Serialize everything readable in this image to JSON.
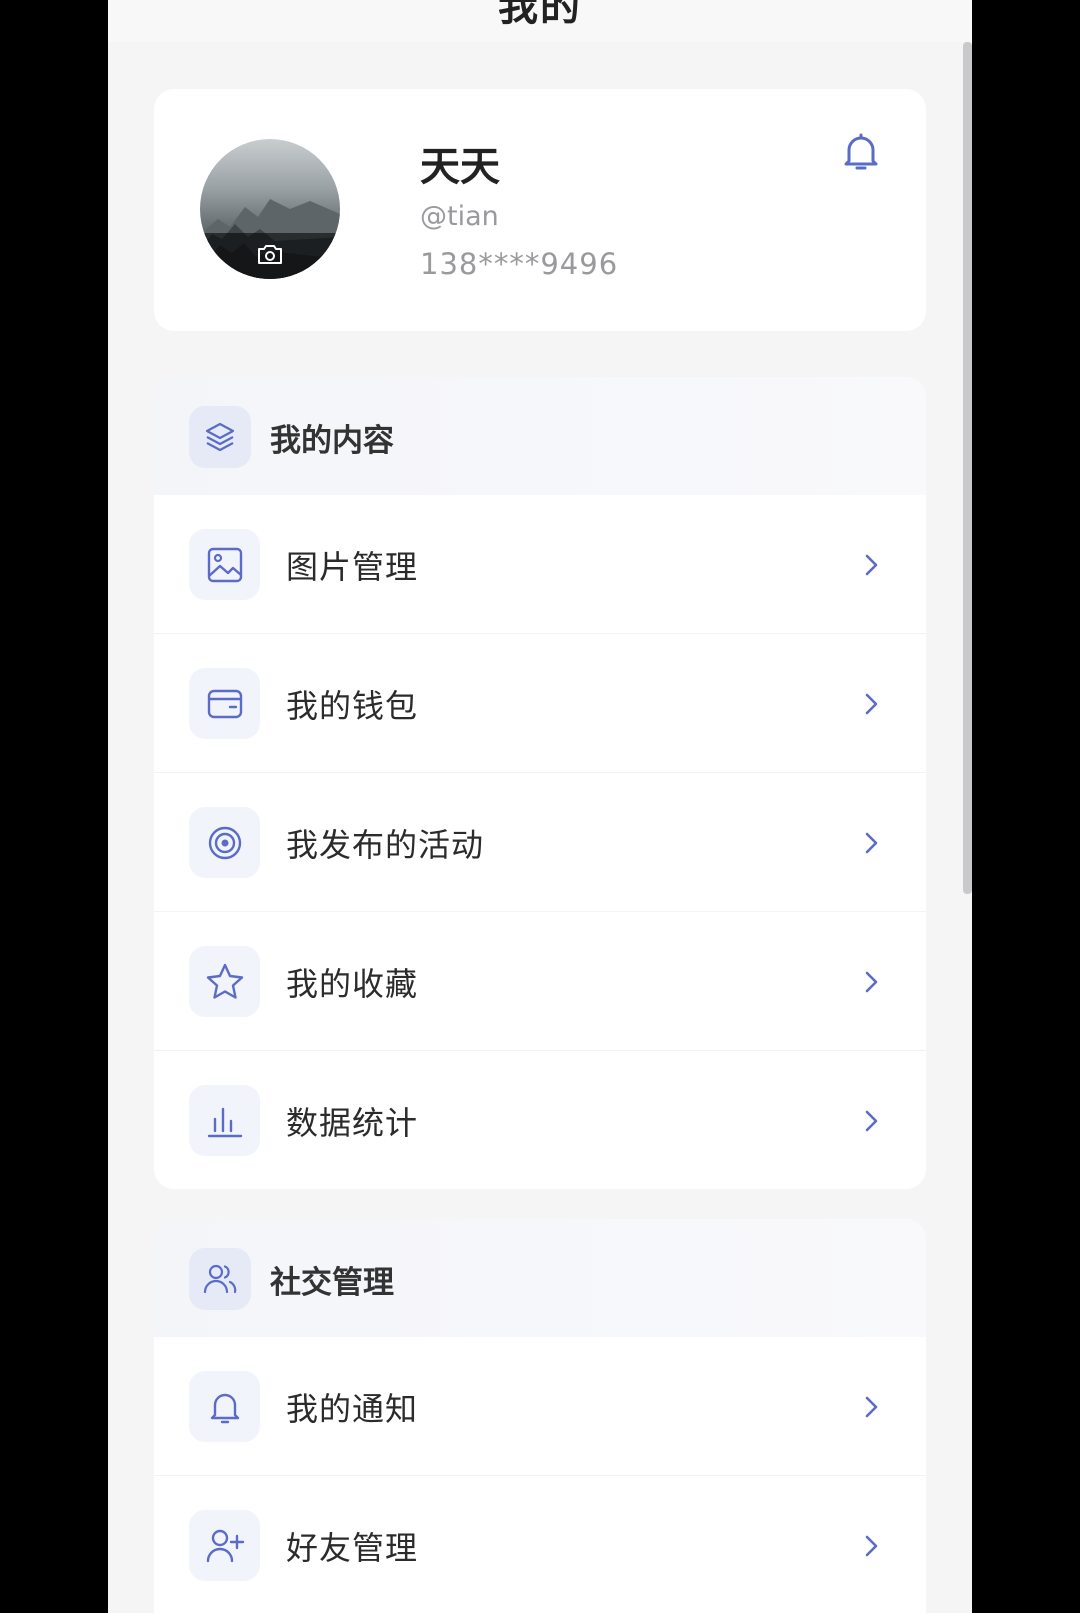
{
  "header": {
    "title": "我的"
  },
  "profile": {
    "name": "天天",
    "handle": "@tian",
    "phone": "138****9496"
  },
  "sections": [
    {
      "title": "我的内容",
      "icon": "layers-icon",
      "items": [
        {
          "label": "图片管理",
          "icon": "image-icon"
        },
        {
          "label": "我的钱包",
          "icon": "wallet-icon"
        },
        {
          "label": "我发布的活动",
          "icon": "target-icon"
        },
        {
          "label": "我的收藏",
          "icon": "star-icon"
        },
        {
          "label": "数据统计",
          "icon": "bar-chart-icon"
        }
      ]
    },
    {
      "title": "社交管理",
      "icon": "users-icon",
      "items": [
        {
          "label": "我的通知",
          "icon": "bell-icon"
        },
        {
          "label": "好友管理",
          "icon": "user-plus-icon"
        }
      ]
    }
  ],
  "colors": {
    "accent": "#5b6cc7",
    "background": "#f5f5f6",
    "card": "#ffffff",
    "icon_bg": "#f2f4fb"
  }
}
